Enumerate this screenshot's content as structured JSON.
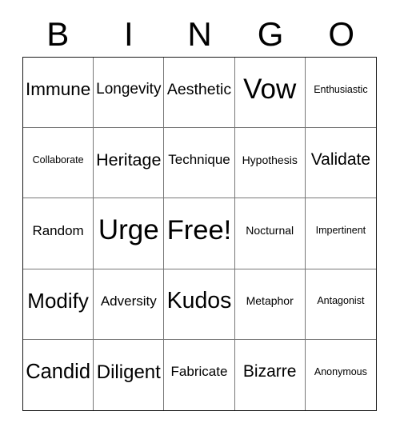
{
  "header": {
    "letters": [
      "B",
      "I",
      "N",
      "G",
      "O"
    ]
  },
  "grid": {
    "rows": [
      [
        {
          "label": "Immune",
          "size": "fs-l"
        },
        {
          "label": "Longevity",
          "size": "fs-m"
        },
        {
          "label": "Aesthetic",
          "size": "fs-m"
        },
        {
          "label": "Vow",
          "size": "fs-xxl"
        },
        {
          "label": "Enthusiastic",
          "size": "fs-xxs"
        }
      ],
      [
        {
          "label": "Collaborate",
          "size": "fs-xxs"
        },
        {
          "label": "Heritage",
          "size": "fs-l"
        },
        {
          "label": "Technique",
          "size": "fs-s"
        },
        {
          "label": "Hypothesis",
          "size": "fs-xs"
        },
        {
          "label": "Validate",
          "size": "fs-m"
        }
      ],
      [
        {
          "label": "Random",
          "size": "fs-s"
        },
        {
          "label": "Urge",
          "size": "fs-xxl"
        },
        {
          "label": "Free!",
          "size": "fs-xxl"
        },
        {
          "label": "Nocturnal",
          "size": "fs-xs"
        },
        {
          "label": "Impertinent",
          "size": "fs-xxs"
        }
      ],
      [
        {
          "label": "Modify",
          "size": "fs-l"
        },
        {
          "label": "Adversity",
          "size": "fs-s"
        },
        {
          "label": "Kudos",
          "size": "fs-xl"
        },
        {
          "label": "Metaphor",
          "size": "fs-xs"
        },
        {
          "label": "Antagonist",
          "size": "fs-xxs"
        }
      ],
      [
        {
          "label": "Candid",
          "size": "fs-l"
        },
        {
          "label": "Diligent",
          "size": "fs-l"
        },
        {
          "label": "Fabricate",
          "size": "fs-s"
        },
        {
          "label": "Bizarre",
          "size": "fs-m"
        },
        {
          "label": "Anonymous",
          "size": "fs-xxs"
        }
      ]
    ]
  },
  "colors": {
    "background": "#ffffff",
    "text": "#000000",
    "outer_border": "#1a1a1a",
    "inner_border": "#777777"
  }
}
